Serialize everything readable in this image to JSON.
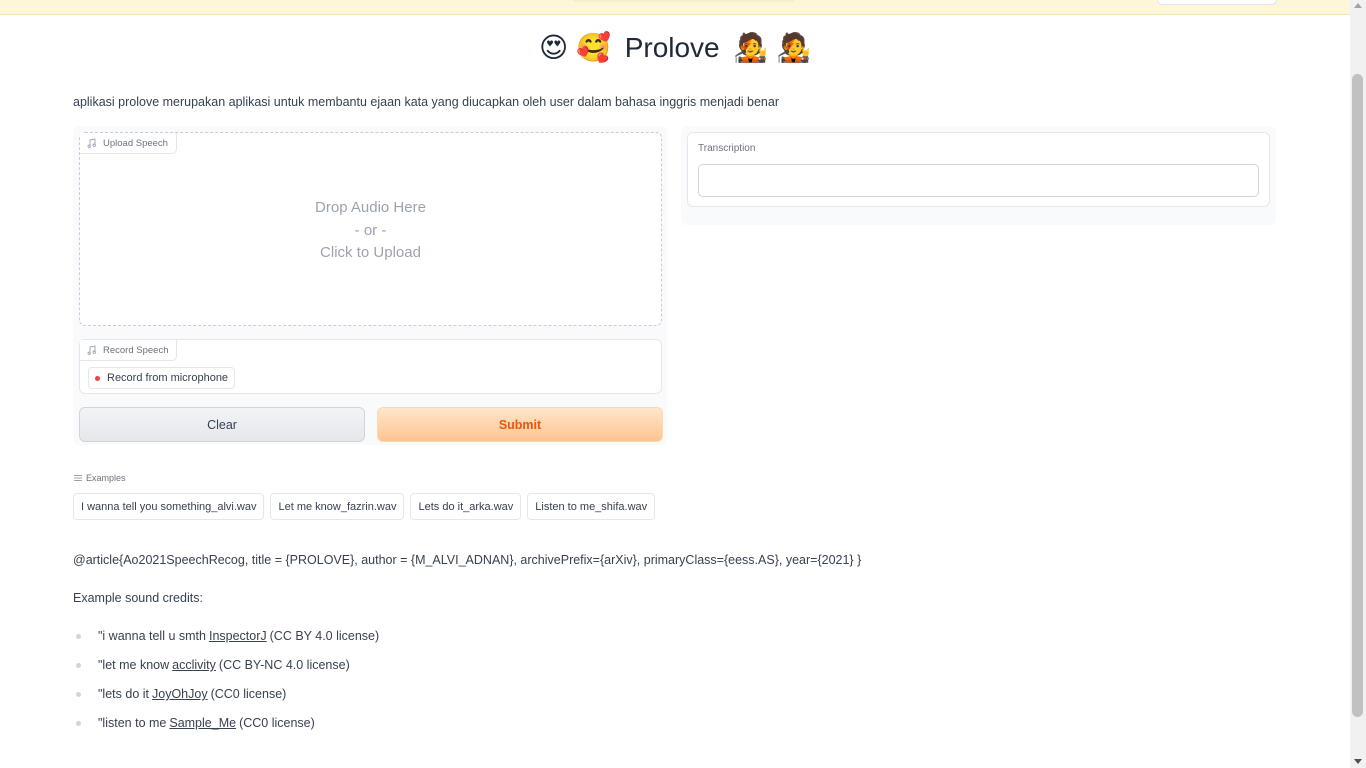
{
  "header": {
    "title": "Prolove",
    "emojis_left": [
      "😍",
      "🥰"
    ],
    "emojis_right": [
      "🧑‍🎤",
      "🧑‍🎤"
    ]
  },
  "description": "aplikasi prolove merupakan aplikasi untuk membantu ejaan kata yang diucapkan oleh user dalam bahasa inggris menjadi benar",
  "upload": {
    "label": "Upload Speech",
    "drop_text": "Drop Audio Here",
    "or_text": "- or -",
    "click_text": "Click to Upload"
  },
  "record": {
    "label": "Record Speech",
    "button": "Record from microphone"
  },
  "buttons": {
    "clear": "Clear",
    "submit": "Submit"
  },
  "transcription": {
    "label": "Transcription",
    "value": ""
  },
  "examples": {
    "label": "Examples",
    "items": [
      "I wanna tell you something_alvi.wav",
      "Let me know_fazrin.wav",
      "Lets do it_arka.wav",
      "Listen to me_shifa.wav"
    ]
  },
  "citation": "@article{Ao2021SpeechRecog, title = {PROLOVE}, author = {M_ALVI_ADNAN}, archivePrefix={arXiv}, primaryClass={eess.AS}, year={2021} }",
  "credits": {
    "heading": "Example sound credits:",
    "items": [
      {
        "prefix": "\"i wanna tell u smth",
        "link": "InspectorJ",
        "suffix": "(CC BY 4.0 license)"
      },
      {
        "prefix": "\"let me know",
        "link": "acclivity",
        "suffix": "(CC BY-NC 4.0 license)"
      },
      {
        "prefix": "\"lets do it",
        "link": "JoyOhJoy",
        "suffix": "(CC0 license)"
      },
      {
        "prefix": "\"listen to me",
        "link": "Sample_Me",
        "suffix": "(CC0 license)"
      }
    ]
  },
  "colors": {
    "banner": "#fdf6d8",
    "submit_text": "#ea580c",
    "submit_bg": "#fdc48f"
  }
}
